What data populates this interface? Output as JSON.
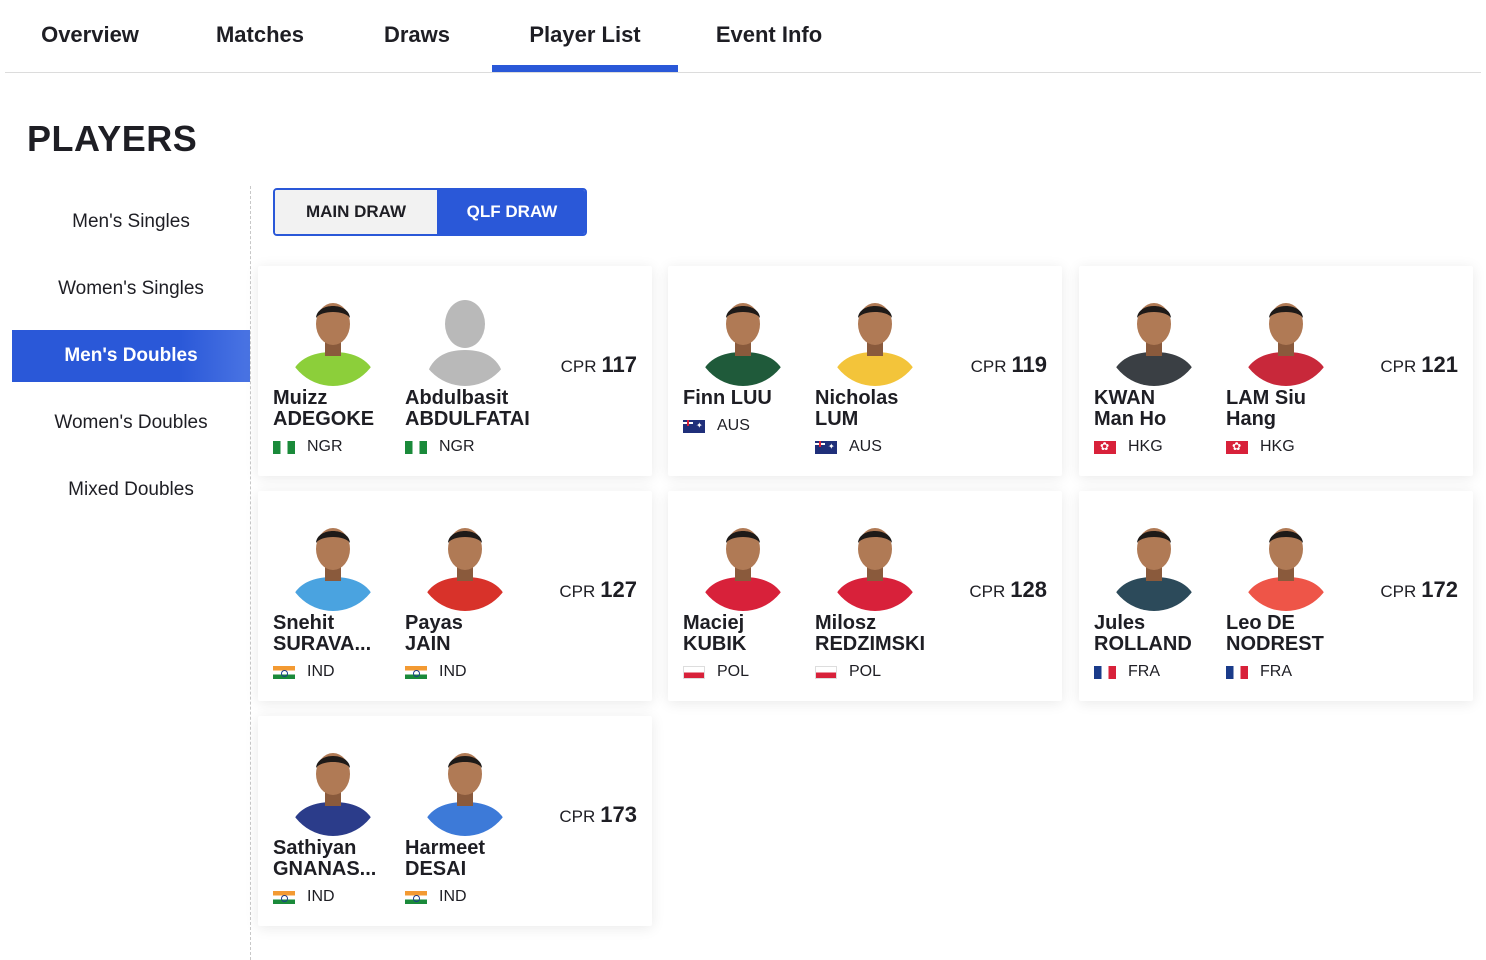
{
  "tabs": [
    {
      "label": "Overview",
      "active": false
    },
    {
      "label": "Matches",
      "active": false
    },
    {
      "label": "Draws",
      "active": false
    },
    {
      "label": "Player List",
      "active": true
    },
    {
      "label": "Event Info",
      "active": false
    }
  ],
  "page_title": "PLAYERS",
  "sidebar": {
    "items": [
      {
        "label": "Men's Singles",
        "active": false
      },
      {
        "label": "Women's Singles",
        "active": false
      },
      {
        "label": "Men's Doubles",
        "active": true
      },
      {
        "label": "Women's Doubles",
        "active": false
      },
      {
        "label": "Mixed Doubles",
        "active": false
      }
    ]
  },
  "draw_toggle": {
    "main": "MAIN DRAW",
    "qlf": "QLF DRAW",
    "selected": "QLF DRAW"
  },
  "accent_color": "#2a58d8",
  "cpr_label": "CPR",
  "pairs": [
    {
      "cpr": "117",
      "players": [
        {
          "first": "Muizz",
          "last": "ADEGOKE",
          "country": "NGR",
          "photo": "photo",
          "shirt": "#8ccf3a"
        },
        {
          "first": "Abdulbasit",
          "last": "ABDULFATAI",
          "country": "NGR",
          "photo": "silhouette-placeholder-icon",
          "shirt": "#bdbdbd"
        }
      ]
    },
    {
      "cpr": "119",
      "players": [
        {
          "first": "Finn LUU",
          "last": "",
          "country": "AUS",
          "photo": "photo",
          "shirt": "#1f5a3a"
        },
        {
          "first": "Nicholas",
          "last": "LUM",
          "country": "AUS",
          "photo": "photo",
          "shirt": "#f3c43a"
        }
      ]
    },
    {
      "cpr": "121",
      "players": [
        {
          "first": "KWAN",
          "last": "Man Ho",
          "country": "HKG",
          "photo": "photo",
          "shirt": "#3a3f44"
        },
        {
          "first": "LAM Siu",
          "last": "Hang",
          "country": "HKG",
          "photo": "photo",
          "shirt": "#c8283a"
        }
      ]
    },
    {
      "cpr": "127",
      "players": [
        {
          "first": "Snehit",
          "last": "SURAVA...",
          "country": "IND",
          "photo": "photo",
          "shirt": "#4aa3e0"
        },
        {
          "first": "Payas",
          "last": "JAIN",
          "country": "IND",
          "photo": "photo",
          "shirt": "#d8322a"
        }
      ]
    },
    {
      "cpr": "128",
      "players": [
        {
          "first": "Maciej",
          "last": "KUBIK",
          "country": "POL",
          "photo": "photo",
          "shirt": "#d8213a"
        },
        {
          "first": "Milosz",
          "last": "REDZIMSKI",
          "country": "POL",
          "photo": "photo",
          "shirt": "#d8213a"
        }
      ]
    },
    {
      "cpr": "172",
      "players": [
        {
          "first": "Jules",
          "last": "ROLLAND",
          "country": "FRA",
          "photo": "photo",
          "shirt": "#2c4a5a"
        },
        {
          "first": "Leo DE",
          "last": "NODREST",
          "country": "FRA",
          "photo": "photo",
          "shirt": "#ee5548"
        }
      ]
    },
    {
      "cpr": "173",
      "players": [
        {
          "first": "Sathiyan",
          "last": "GNANAS...",
          "country": "IND",
          "photo": "photo",
          "shirt": "#2b3c8a"
        },
        {
          "first": "Harmeet",
          "last": "DESAI",
          "country": "IND",
          "photo": "photo",
          "shirt": "#3d7ad8"
        }
      ]
    }
  ]
}
